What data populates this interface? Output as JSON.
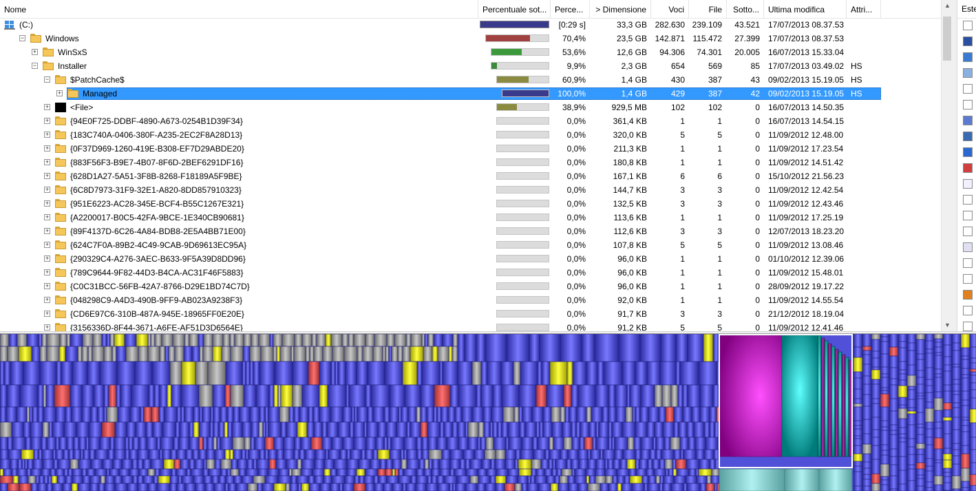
{
  "columns": {
    "name": "Nome",
    "subtree_pct": "Percentuale sot...",
    "percent": "Perce...",
    "size": "> Dimensione",
    "items": "Voci",
    "files": "File",
    "subdirs": "Sotto...",
    "modified": "Ultima modifica",
    "attributes": "Attri..."
  },
  "extension_panel": {
    "header": "Este"
  },
  "colors": {
    "selection": "#3399ff",
    "bar_root": "#3a3a8c",
    "bar_windows": "#a04040",
    "bar_winsxs": "#3c9a3c",
    "bar_installer": "#3c8a3c",
    "bar_olive": "#8a8a40",
    "bar_managed": "#3a3a8c",
    "treemap_blue": "#5050d8",
    "treemap_magenta": "#c000c0",
    "treemap_teal": "#00a0a0"
  },
  "rows": [
    {
      "level": 0,
      "icon": "drive-icon",
      "expander": "",
      "name": "(C:)",
      "pct_text": "[0:29 s]",
      "fill": 1.0,
      "bar": "bar_root",
      "size": "33,3 GB",
      "items": "282.630",
      "files": "239.109",
      "subdirs": "43.521",
      "modified": "17/07/2013  08.37.53",
      "attr": "",
      "selected": false
    },
    {
      "level": 1,
      "icon": "folder-icon",
      "expander": "−",
      "name": "Windows",
      "pct_text": "70,4%",
      "fill": 0.704,
      "bar": "bar_windows",
      "size": "23,5 GB",
      "items": "142.871",
      "files": "115.472",
      "subdirs": "27.399",
      "modified": "17/07/2013  08.37.53",
      "attr": "",
      "selected": false
    },
    {
      "level": 2,
      "icon": "folder-icon",
      "expander": "+",
      "name": "WinSxS",
      "pct_text": "53,6%",
      "fill": 0.536,
      "bar": "bar_winsxs",
      "size": "12,6 GB",
      "items": "94.306",
      "files": "74.301",
      "subdirs": "20.005",
      "modified": "16/07/2013  15.33.04",
      "attr": "",
      "selected": false
    },
    {
      "level": 2,
      "icon": "folder-icon",
      "expander": "−",
      "name": "Installer",
      "pct_text": "9,9%",
      "fill": 0.099,
      "bar": "bar_installer",
      "size": "2,3 GB",
      "items": "654",
      "files": "569",
      "subdirs": "85",
      "modified": "17/07/2013  03.49.02",
      "attr": "HS",
      "selected": false
    },
    {
      "level": 3,
      "icon": "folder-icon",
      "expander": "−",
      "name": "$PatchCache$",
      "pct_text": "60,9%",
      "fill": 0.609,
      "bar": "bar_olive",
      "size": "1,4 GB",
      "items": "430",
      "files": "387",
      "subdirs": "43",
      "modified": "09/02/2013  15.19.05",
      "attr": "HS",
      "selected": false
    },
    {
      "level": 4,
      "icon": "folder-icon",
      "expander": "+",
      "name": "Managed",
      "pct_text": "100,0%",
      "fill": 1.0,
      "bar": "bar_managed",
      "size": "1,4 GB",
      "items": "429",
      "files": "387",
      "subdirs": "42",
      "modified": "09/02/2013  15.19.05",
      "attr": "HS",
      "selected": true
    },
    {
      "level": 3,
      "icon": "black-square-icon",
      "expander": "+",
      "name": "<File>",
      "pct_text": "38,9%",
      "fill": 0.389,
      "bar": "bar_olive",
      "size": "929,5 MB",
      "items": "102",
      "files": "102",
      "subdirs": "0",
      "modified": "16/07/2013  14.50.35",
      "attr": "",
      "selected": false
    },
    {
      "level": 3,
      "icon": "folder-icon",
      "expander": "+",
      "name": "{94E0F725-DDBF-4890-A673-0254B1D39F34}",
      "pct_text": "0,0%",
      "fill": 0,
      "bar": "bar_olive",
      "size": "361,4 KB",
      "items": "1",
      "files": "1",
      "subdirs": "0",
      "modified": "16/07/2013  14.54.15",
      "attr": "",
      "selected": false
    },
    {
      "level": 3,
      "icon": "folder-icon",
      "expander": "+",
      "name": "{183C740A-0406-380F-A235-2EC2F8A28D13}",
      "pct_text": "0,0%",
      "fill": 0,
      "bar": "bar_olive",
      "size": "320,0 KB",
      "items": "5",
      "files": "5",
      "subdirs": "0",
      "modified": "11/09/2012  12.48.00",
      "attr": "",
      "selected": false
    },
    {
      "level": 3,
      "icon": "folder-icon",
      "expander": "+",
      "name": "{0F37D969-1260-419E-B308-EF7D29ABDE20}",
      "pct_text": "0,0%",
      "fill": 0,
      "bar": "bar_olive",
      "size": "211,3 KB",
      "items": "1",
      "files": "1",
      "subdirs": "0",
      "modified": "11/09/2012  17.23.54",
      "attr": "",
      "selected": false
    },
    {
      "level": 3,
      "icon": "folder-icon",
      "expander": "+",
      "name": "{883F56F3-B9E7-4B07-8F6D-2BEF6291DF16}",
      "pct_text": "0,0%",
      "fill": 0,
      "bar": "bar_olive",
      "size": "180,8 KB",
      "items": "1",
      "files": "1",
      "subdirs": "0",
      "modified": "11/09/2012  14.51.42",
      "attr": "",
      "selected": false
    },
    {
      "level": 3,
      "icon": "folder-icon",
      "expander": "+",
      "name": "{628D1A27-5A51-3F8B-8268-F18189A5F9BE}",
      "pct_text": "0,0%",
      "fill": 0,
      "bar": "bar_olive",
      "size": "167,1 KB",
      "items": "6",
      "files": "6",
      "subdirs": "0",
      "modified": "15/10/2012  21.56.23",
      "attr": "",
      "selected": false
    },
    {
      "level": 3,
      "icon": "folder-icon",
      "expander": "+",
      "name": "{6C8D7973-31F9-32E1-A820-8DD857910323}",
      "pct_text": "0,0%",
      "fill": 0,
      "bar": "bar_olive",
      "size": "144,7 KB",
      "items": "3",
      "files": "3",
      "subdirs": "0",
      "modified": "11/09/2012  12.42.54",
      "attr": "",
      "selected": false
    },
    {
      "level": 3,
      "icon": "folder-icon",
      "expander": "+",
      "name": "{951E6223-AC28-345E-BCF4-B55C1267E321}",
      "pct_text": "0,0%",
      "fill": 0,
      "bar": "bar_olive",
      "size": "132,5 KB",
      "items": "3",
      "files": "3",
      "subdirs": "0",
      "modified": "11/09/2012  12.43.46",
      "attr": "",
      "selected": false
    },
    {
      "level": 3,
      "icon": "folder-icon",
      "expander": "+",
      "name": "{A2200017-B0C5-42FA-9BCE-1E340CB90681}",
      "pct_text": "0,0%",
      "fill": 0,
      "bar": "bar_olive",
      "size": "113,6 KB",
      "items": "1",
      "files": "1",
      "subdirs": "0",
      "modified": "11/09/2012  17.25.19",
      "attr": "",
      "selected": false
    },
    {
      "level": 3,
      "icon": "folder-icon",
      "expander": "+",
      "name": "{89F4137D-6C26-4A84-BDB8-2E5A4BB71E00}",
      "pct_text": "0,0%",
      "fill": 0,
      "bar": "bar_olive",
      "size": "112,6 KB",
      "items": "3",
      "files": "3",
      "subdirs": "0",
      "modified": "12/07/2013  18.23.20",
      "attr": "",
      "selected": false
    },
    {
      "level": 3,
      "icon": "folder-icon",
      "expander": "+",
      "name": "{624C7F0A-89B2-4C49-9CAB-9D69613EC95A}",
      "pct_text": "0,0%",
      "fill": 0,
      "bar": "bar_olive",
      "size": "107,8 KB",
      "items": "5",
      "files": "5",
      "subdirs": "0",
      "modified": "11/09/2012  13.08.46",
      "attr": "",
      "selected": false
    },
    {
      "level": 3,
      "icon": "folder-icon",
      "expander": "+",
      "name": "{290329C4-A276-3AEC-B633-9F5A39D8DD96}",
      "pct_text": "0,0%",
      "fill": 0,
      "bar": "bar_olive",
      "size": "96,0 KB",
      "items": "1",
      "files": "1",
      "subdirs": "0",
      "modified": "01/10/2012  12.39.06",
      "attr": "",
      "selected": false
    },
    {
      "level": 3,
      "icon": "folder-icon",
      "expander": "+",
      "name": "{789C9644-9F82-44D3-B4CA-AC31F46F5883}",
      "pct_text": "0,0%",
      "fill": 0,
      "bar": "bar_olive",
      "size": "96,0 KB",
      "items": "1",
      "files": "1",
      "subdirs": "0",
      "modified": "11/09/2012  15.48.01",
      "attr": "",
      "selected": false
    },
    {
      "level": 3,
      "icon": "folder-icon",
      "expander": "+",
      "name": "{C0C31BCC-56FB-42A7-8766-D29E1BD74C7D}",
      "pct_text": "0,0%",
      "fill": 0,
      "bar": "bar_olive",
      "size": "96,0 KB",
      "items": "1",
      "files": "1",
      "subdirs": "0",
      "modified": "28/09/2012  19.17.22",
      "attr": "",
      "selected": false
    },
    {
      "level": 3,
      "icon": "folder-icon",
      "expander": "+",
      "name": "{048298C9-A4D3-490B-9FF9-AB023A9238F3}",
      "pct_text": "0,0%",
      "fill": 0,
      "bar": "bar_olive",
      "size": "92,0 KB",
      "items": "1",
      "files": "1",
      "subdirs": "0",
      "modified": "11/09/2012  14.55.54",
      "attr": "",
      "selected": false
    },
    {
      "level": 3,
      "icon": "folder-icon",
      "expander": "+",
      "name": "{CD6E97C6-310B-487A-945E-18965FF0E20E}",
      "pct_text": "0,0%",
      "fill": 0,
      "bar": "bar_olive",
      "size": "91,7 KB",
      "items": "3",
      "files": "3",
      "subdirs": "0",
      "modified": "21/12/2012  18.19.04",
      "attr": "",
      "selected": false
    },
    {
      "level": 3,
      "icon": "folder-icon",
      "expander": "+",
      "name": "{3156336D-8F44-3671-A6FE-AF51D3D6564E}",
      "pct_text": "0,0%",
      "fill": 0,
      "bar": "bar_olive",
      "size": "91,2 KB",
      "items": "5",
      "files": "5",
      "subdirs": "0",
      "modified": "11/09/2012  12.41.46",
      "attr": "",
      "selected": false
    }
  ]
}
